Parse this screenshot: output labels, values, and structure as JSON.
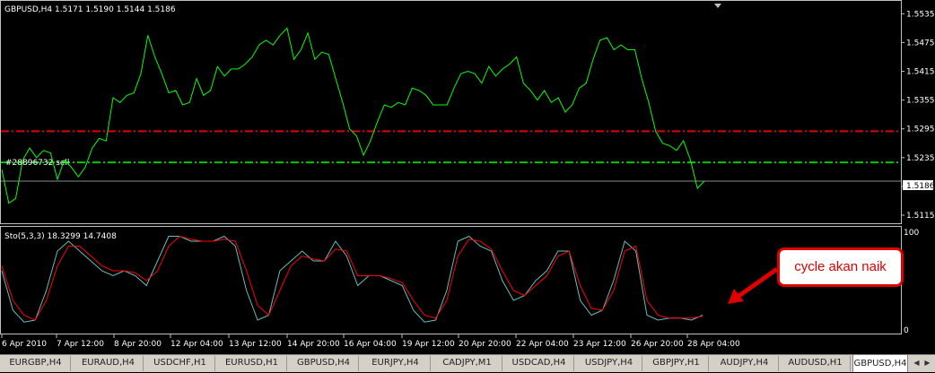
{
  "window": {
    "symbol_header": "GBPUSD,H4  1.5171 1.5190 1.5144 1.5186",
    "order_label": "#28896732 sell",
    "current_price": "1.5186"
  },
  "price_axis": [
    "1.5535",
    "1.5475",
    "1.5415",
    "1.5355",
    "1.5295",
    "1.5235",
    "1.5175",
    "1.5115"
  ],
  "indicator": {
    "label": "Sto(5,3,3) 18.3299 14.7408",
    "axis_top": "100",
    "axis_bottom": "0"
  },
  "time_axis": [
    "6 Apr 2010",
    "7 Apr 12:00",
    "8 Apr 20:00",
    "12 Apr 04:00",
    "13 Apr 12:00",
    "14 Apr 20:00",
    "16 Apr 04:00",
    "19 Apr 12:00",
    "20 Apr 20:00",
    "22 Apr 04:00",
    "23 Apr 12:00",
    "26 Apr 20:00",
    "28 Apr 04:00"
  ],
  "annotation": {
    "text": "cycle akan naik"
  },
  "tabs": [
    {
      "label": "EURGBP,H4",
      "active": false
    },
    {
      "label": "EURAUD,H4",
      "active": false
    },
    {
      "label": "USDCHF,H1",
      "active": false
    },
    {
      "label": "EURUSD,H1",
      "active": false
    },
    {
      "label": "GBPUSD,H4",
      "active": false
    },
    {
      "label": "EURJPY,H4",
      "active": false
    },
    {
      "label": "CADJPY,M1",
      "active": false
    },
    {
      "label": "USDCAD,H4",
      "active": false
    },
    {
      "label": "USDJPY,H4",
      "active": false
    },
    {
      "label": "GBPJPY,H1",
      "active": false
    },
    {
      "label": "AUDJPY,H4",
      "active": false
    },
    {
      "label": "AUDUSD,H1",
      "active": false
    },
    {
      "label": "GBPUSD,H4",
      "active": true
    }
  ],
  "colors": {
    "price_line": "#00ff00",
    "red_level": "#e00000",
    "green_level": "#00cc00",
    "stoch_main": "#5fbfbf",
    "stoch_signal": "#ff0000",
    "annotation": "#e00000"
  },
  "chart_data": {
    "type": "line",
    "price": [
      1.521,
      1.514,
      1.515,
      1.523,
      1.5255,
      1.5235,
      1.525,
      1.5245,
      1.519,
      1.523,
      1.5215,
      1.5195,
      1.5215,
      1.5255,
      1.5275,
      1.527,
      1.536,
      1.535,
      1.5365,
      1.537,
      1.541,
      1.549,
      1.5445,
      1.541,
      1.537,
      1.5375,
      1.5345,
      1.535,
      1.54,
      1.5365,
      1.5375,
      1.5425,
      1.5405,
      1.542,
      1.542,
      1.543,
      1.5445,
      1.547,
      1.548,
      1.547,
      1.549,
      1.5505,
      1.544,
      1.546,
      1.5495,
      1.544,
      1.5455,
      1.545,
      1.54,
      1.535,
      1.5295,
      1.528,
      1.524,
      1.527,
      1.531,
      1.5345,
      1.534,
      1.535,
      1.5345,
      1.538,
      1.5375,
      1.5365,
      1.5345,
      1.5345,
      1.5345,
      1.538,
      1.541,
      1.5415,
      1.541,
      1.539,
      1.5425,
      1.5405,
      1.542,
      1.543,
      1.5445,
      1.539,
      1.5375,
      1.5355,
      1.5375,
      1.535,
      1.536,
      1.533,
      1.5345,
      1.538,
      1.539,
      1.544,
      1.548,
      1.5485,
      1.546,
      1.547,
      1.546,
      1.546,
      1.54,
      1.535,
      1.529,
      1.5265,
      1.526,
      1.525,
      1.527,
      1.523,
      1.5171,
      1.5186
    ],
    "stoch_main": [
      60,
      20,
      8,
      10,
      40,
      80,
      90,
      80,
      70,
      60,
      55,
      60,
      55,
      45,
      70,
      95,
      95,
      90,
      90,
      90,
      95,
      85,
      40,
      10,
      15,
      60,
      70,
      80,
      70,
      70,
      90,
      75,
      45,
      55,
      55,
      50,
      45,
      20,
      8,
      10,
      40,
      90,
      95,
      85,
      80,
      50,
      30,
      35,
      50,
      60,
      80,
      80,
      30,
      15,
      20,
      50,
      90,
      80,
      15,
      10,
      12,
      12,
      10,
      15
    ],
    "stoch_signal": [
      65,
      30,
      15,
      10,
      30,
      65,
      85,
      85,
      75,
      65,
      60,
      60,
      58,
      50,
      60,
      85,
      95,
      92,
      90,
      90,
      92,
      90,
      60,
      25,
      15,
      40,
      65,
      75,
      72,
      70,
      82,
      80,
      55,
      55,
      55,
      52,
      48,
      30,
      15,
      12,
      30,
      75,
      92,
      90,
      82,
      60,
      40,
      35,
      45,
      55,
      75,
      80,
      45,
      22,
      20,
      40,
      80,
      85,
      30,
      15,
      12,
      12,
      12,
      14
    ],
    "levels": {
      "red_dashdot": 1.529,
      "green_dashdot": 1.5225,
      "current": 1.5186
    },
    "price_range": [
      1.51,
      1.556
    ],
    "stoch_range": [
      0,
      100
    ]
  }
}
